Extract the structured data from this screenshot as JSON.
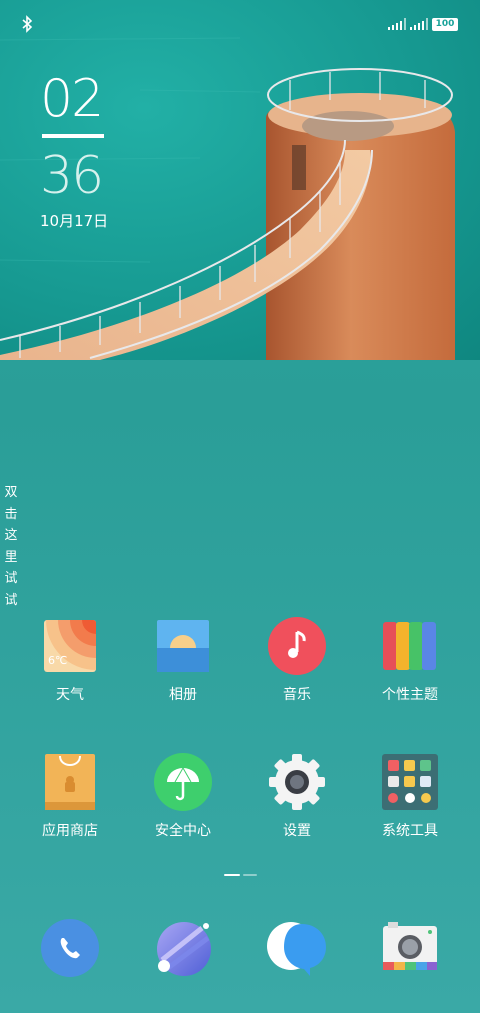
{
  "status_bar": {
    "bluetooth_icon": "bluetooth-icon",
    "signal_icons": [
      "signal-1-icon",
      "signal-2-icon"
    ],
    "battery_level": "100"
  },
  "lockclock": {
    "hour": "02",
    "minute": "36",
    "date": "10月17日"
  },
  "side_hint": {
    "chars": [
      "双",
      "击",
      "这",
      "里",
      "试",
      "试"
    ]
  },
  "apps_row1": [
    {
      "label": "天气",
      "icon": "weather-icon",
      "temp": "6℃"
    },
    {
      "label": "相册",
      "icon": "gallery-icon"
    },
    {
      "label": "音乐",
      "icon": "music-icon"
    },
    {
      "label": "个性主题",
      "icon": "themes-icon"
    }
  ],
  "apps_row2": [
    {
      "label": "应用商店",
      "icon": "app-store-icon"
    },
    {
      "label": "安全中心",
      "icon": "security-icon"
    },
    {
      "label": "设置",
      "icon": "settings-icon"
    },
    {
      "label": "系统工具",
      "icon": "system-tools-icon"
    }
  ],
  "page_indicator": {
    "current": 1,
    "total": 2
  },
  "dock": [
    {
      "icon": "phone-icon"
    },
    {
      "icon": "browser-icon"
    },
    {
      "icon": "messages-icon"
    },
    {
      "icon": "camera-icon"
    }
  ],
  "colors": {
    "background": "#2aa7a0",
    "music": "#f0505c",
    "security": "#3ecf6d",
    "dock_phone": "#4a90e2"
  }
}
